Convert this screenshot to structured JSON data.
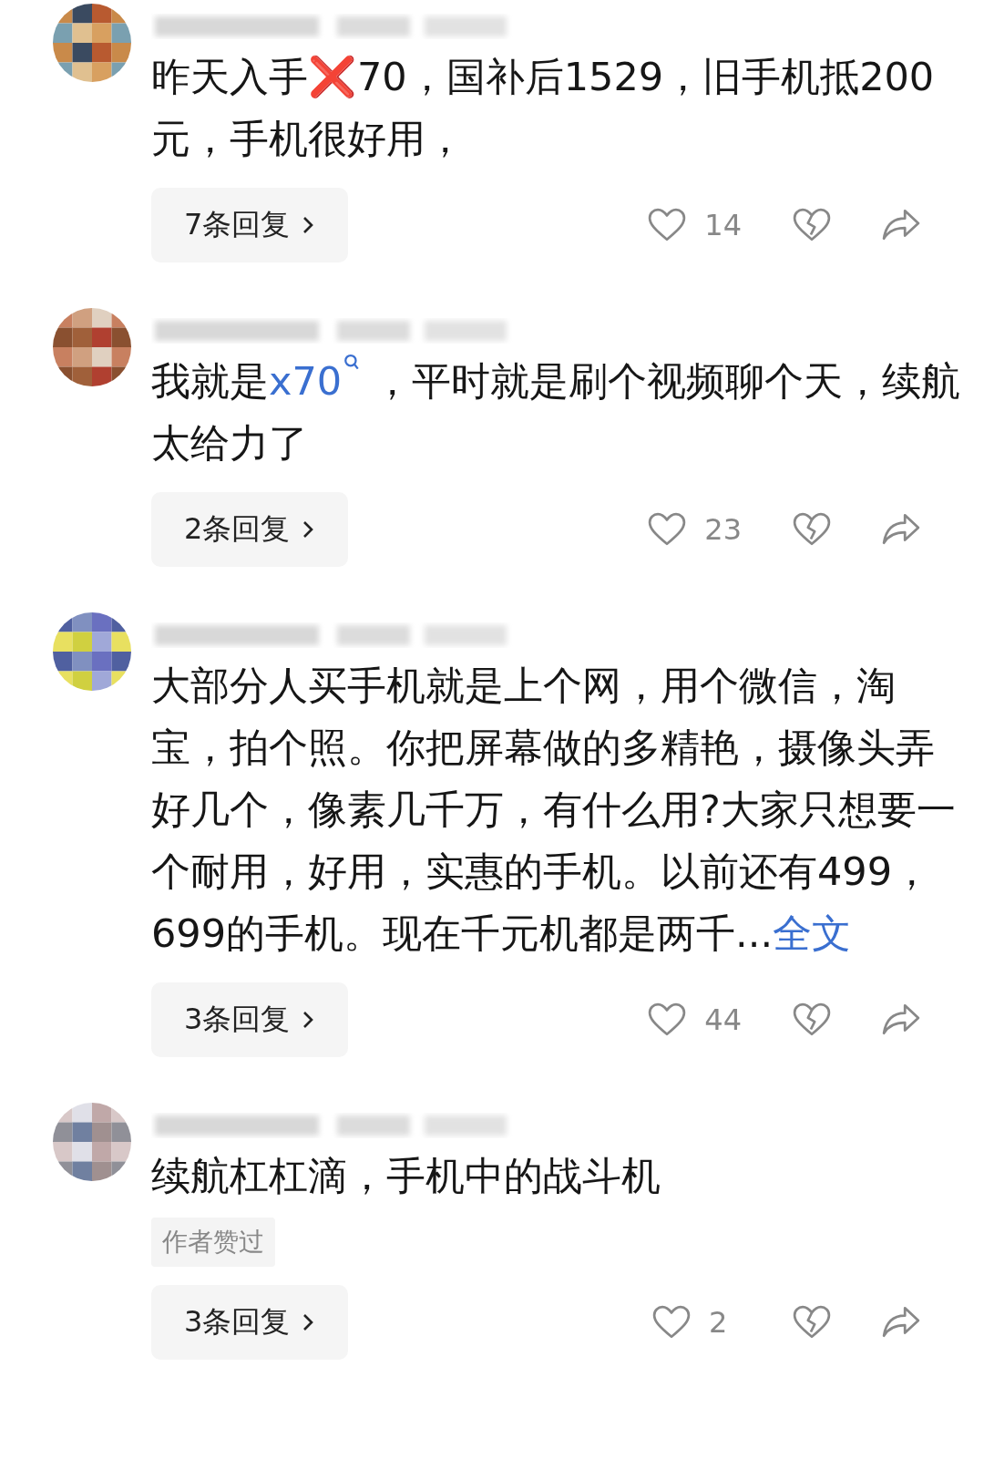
{
  "comments": [
    {
      "text": [
        {
          "kind": "plain",
          "text": "昨天入手❌70，国补后1529，旧手机抵200元，手机很好用，"
        }
      ],
      "replies": "7条回复",
      "liked": false,
      "likes": "14"
    },
    {
      "text": [
        {
          "kind": "plain",
          "text": "我就是"
        },
        {
          "kind": "search_link",
          "text": "x70"
        },
        {
          "kind": "plain",
          "text": " ，平时就是刷个视频聊个天，续航太给力了"
        }
      ],
      "replies": "2条回复",
      "liked": false,
      "likes": "23"
    },
    {
      "text": [
        {
          "kind": "plain",
          "text": "大部分人买手机就是上个网，用个微信，淘宝，拍个照。你把屏幕做的多精艳，摄像头弄好几个，像素几千万，有什么用?大家只想要一个耐用，好用，实惠的手机。以前还有499，699的手机。现在千元机都是两千..."
        },
        {
          "kind": "link",
          "text": "全文"
        }
      ],
      "replies": "3条回复",
      "liked": false,
      "likes": "44"
    },
    {
      "text": [
        {
          "kind": "plain",
          "text": "续航杠杠滴，手机中的战斗机"
        }
      ],
      "badge": "作者赞过",
      "replies": "3条回复",
      "liked": false,
      "likes": "2"
    }
  ]
}
